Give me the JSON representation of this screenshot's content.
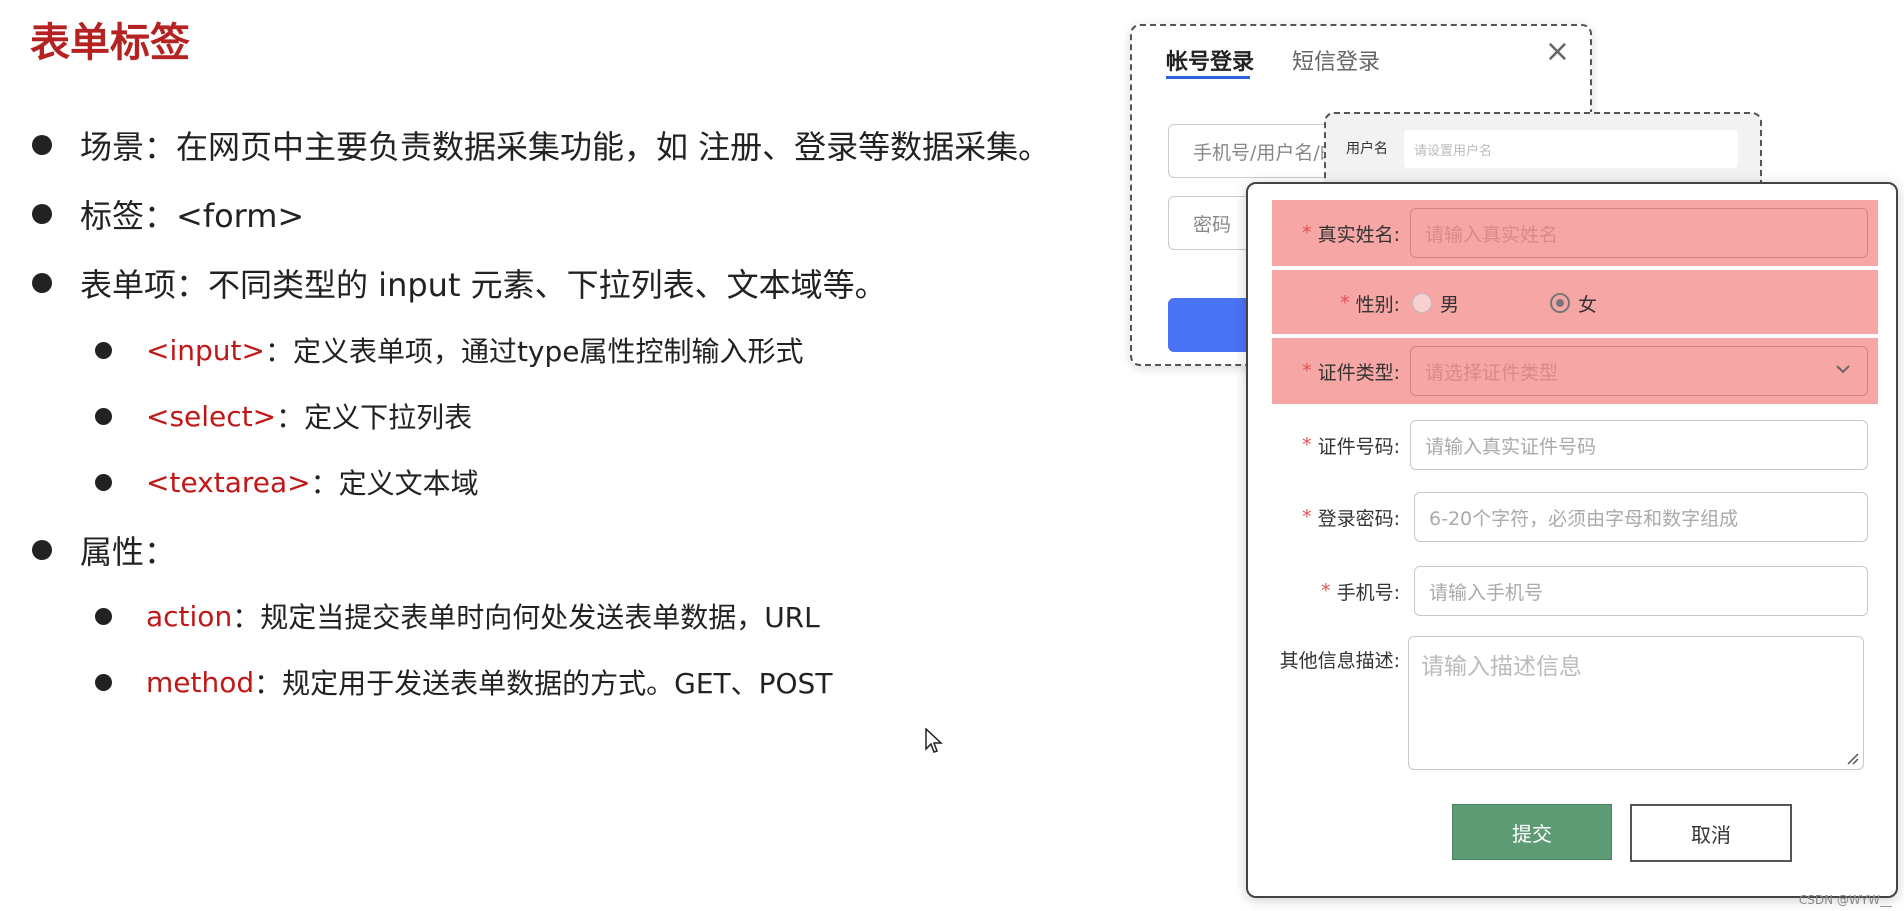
{
  "slide": {
    "title": "表单标签",
    "bullets": {
      "scene": "场景：在网页中主要负责数据采集功能，如 注册、登录等数据采集。",
      "tag": "标签：<form>",
      "items": "表单项：不同类型的 input 元素、下拉列表、文本域等。",
      "input_tag": "<input>",
      "input_desc": "：定义表单项，通过type属性控制输入形式",
      "select_tag": "<select>",
      "select_desc": "：定义下拉列表",
      "textarea_tag": "<textarea>",
      "textarea_desc": "：定义文本域",
      "attrs": "属性：",
      "action_name": "action",
      "action_desc": "：规定当提交表单时向何处发送表单数据，URL",
      "method_name": "method",
      "method_desc": "：规定用于发送表单数据的方式。GET、POST"
    }
  },
  "login_card": {
    "tab_account": "帐号登录",
    "tab_sms": "短信登录",
    "close_icon": "×",
    "account_placeholder": "手机号/用户名/邮",
    "password_placeholder": "密码"
  },
  "register_card": {
    "username_label": "用户名",
    "username_placeholder": "请设置用户名"
  },
  "form": {
    "required_mark": "*",
    "realname_label": "真实姓名:",
    "realname_placeholder": "请输入真实姓名",
    "gender_label": "性别:",
    "gender_male": "男",
    "gender_female": "女",
    "gender_selected": "女",
    "idtype_label": "证件类型:",
    "idtype_placeholder": "请选择证件类型",
    "idno_label": "证件号码:",
    "idno_placeholder": "请输入真实证件号码",
    "password_label": "登录密码:",
    "password_placeholder": "6-20个字符，必须由字母和数字组成",
    "phone_label": "手机号:",
    "phone_placeholder": "请输入手机号",
    "desc_label": "其他信息描述:",
    "desc_placeholder": "请输入描述信息",
    "submit_label": "提交",
    "cancel_label": "取消"
  },
  "watermark": "CSDN @WYW__",
  "colors": {
    "title_red": "#b42222",
    "keyword_red": "#c01818",
    "highlight_pink": "#f7a6a6",
    "submit_green": "#5d9b74",
    "login_blue": "#4a72f5"
  }
}
